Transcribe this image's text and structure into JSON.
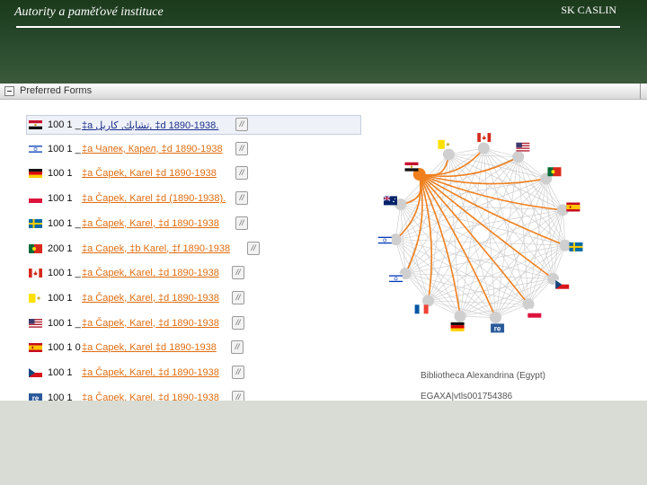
{
  "slide": {
    "title": "Autority a paměťové instituce",
    "label": "SK CASLIN"
  },
  "panel": {
    "title": "Preferred Forms"
  },
  "records": [
    {
      "flag": "egypt",
      "tag": "100 1  _",
      "field": "‡a  تشابك, كاريل, ‡d  1890-1938."
    },
    {
      "flag": "israel",
      "tag": "100 1  _",
      "field": "‡a  Чапек, Карел, ‡d  1890-1938"
    },
    {
      "flag": "germany",
      "tag": "100 1",
      "field": "‡a  Čapek, Karel ‡d  1890-1938"
    },
    {
      "flag": "poland",
      "tag": "100 1",
      "field": "‡a  Čapek, Karel ‡d  (1890-1938)."
    },
    {
      "flag": "sweden",
      "tag": "100 1  _",
      "field": "‡a  Čapek, Karel, ‡d  1890-1938"
    },
    {
      "flag": "portugal",
      "tag": "200     1",
      "field": "‡a  Capek, ‡b  Karel, ‡f  1890-1938"
    },
    {
      "flag": "canada",
      "tag": "100 1  _",
      "field": "‡a  Čapek, Karel, ‡d  1890-1938"
    },
    {
      "flag": "vatican",
      "tag": "100 1",
      "field": "‡a  Čapek, Karel, ‡d  1890-1938"
    },
    {
      "flag": "usa",
      "tag": "100 1  _",
      "field": "‡a  Čapek, Karel, ‡d  1890-1938"
    },
    {
      "flag": "spain",
      "tag": "100 1 0",
      "field": "‡a  Capek, Karel ‡d  1890-1938"
    },
    {
      "flag": "czech",
      "tag": "100 1",
      "field": "‡a  Čapek, Karel, ‡d  1890-1938"
    },
    {
      "flag": "re",
      "tag": "100 1  _",
      "field": "‡a  Čapek, Karel, ‡d  1890-1938"
    }
  ],
  "field_icon_glyph": "//",
  "graph": {
    "highlight_color": "#f0801e",
    "selected_node": "egypt",
    "nodes": [
      {
        "flag": "vatican"
      },
      {
        "flag": "canada"
      },
      {
        "flag": "usa"
      },
      {
        "flag": "portugal"
      },
      {
        "flag": "spain"
      },
      {
        "flag": "sweden"
      },
      {
        "flag": "czech"
      },
      {
        "flag": "poland"
      },
      {
        "flag": "re"
      },
      {
        "flag": "germany"
      },
      {
        "flag": "france"
      },
      {
        "flag": "israel"
      },
      {
        "flag": "israel"
      },
      {
        "flag": "australia"
      },
      {
        "flag": "egypt"
      }
    ],
    "caption_name": "Bibliotheca Alexandrina (Egypt)",
    "caption_id": "EGAXA|vtls001754386"
  }
}
